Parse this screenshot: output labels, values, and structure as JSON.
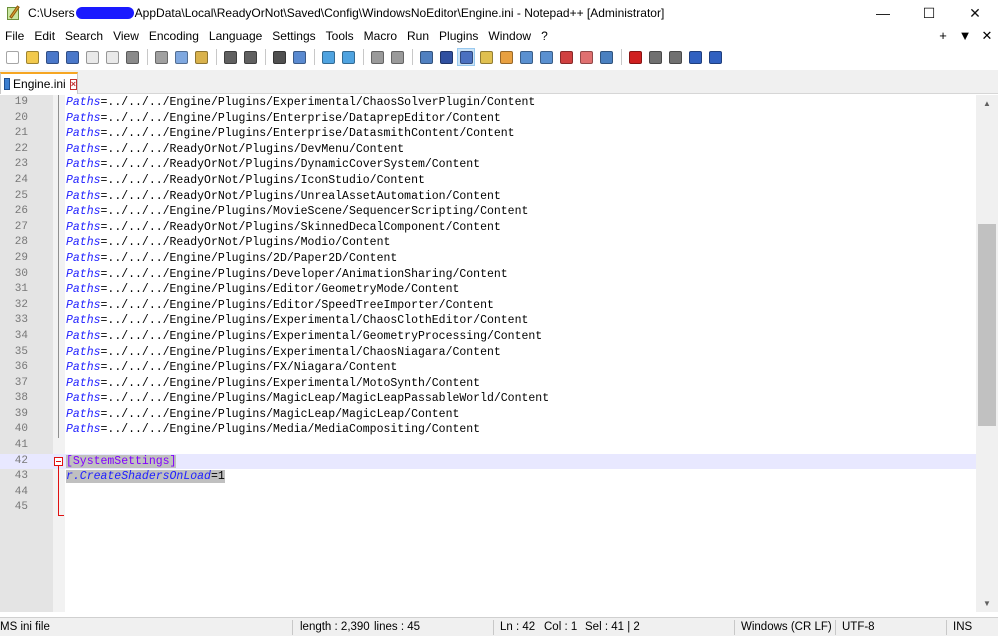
{
  "window": {
    "title_prefix": "C:\\Users",
    "title_suffix": "AppData\\Local\\ReadyOrNot\\Saved\\Config\\WindowsNoEditor\\Engine.ini - Notepad++ [Administrator]",
    "minimize_glyph": "—",
    "maximize_glyph": "☐",
    "close_glyph": "✕"
  },
  "menu": {
    "items": [
      "File",
      "Edit",
      "Search",
      "View",
      "Encoding",
      "Language",
      "Settings",
      "Tools",
      "Macro",
      "Run",
      "Plugins",
      "Window",
      "?"
    ],
    "right": {
      "plus": "+",
      "down": "▼",
      "close": "✕"
    }
  },
  "toolbar": {
    "buttons": [
      {
        "icon": "new-file-icon",
        "color": "#ffffff"
      },
      {
        "icon": "open-file-icon",
        "color": "#f2c94c"
      },
      {
        "icon": "save-icon",
        "color": "#4a77c9"
      },
      {
        "icon": "save-all-icon",
        "color": "#4a77c9"
      },
      {
        "icon": "close-file-icon",
        "color": "#e9e9e9"
      },
      {
        "icon": "close-all-icon",
        "color": "#e9e9e9"
      },
      {
        "icon": "print-icon",
        "color": "#8a8a8a"
      },
      {
        "sep": true
      },
      {
        "icon": "cut-icon",
        "color": "#a0a0a0"
      },
      {
        "icon": "copy-icon",
        "color": "#7fa8e0"
      },
      {
        "icon": "paste-icon",
        "color": "#d9b24c"
      },
      {
        "sep": true
      },
      {
        "icon": "undo-icon",
        "color": "#606060"
      },
      {
        "icon": "redo-icon",
        "color": "#606060"
      },
      {
        "sep": true
      },
      {
        "icon": "find-icon",
        "color": "#505050"
      },
      {
        "icon": "replace-icon",
        "color": "#5a8ad0"
      },
      {
        "sep": true
      },
      {
        "icon": "zoom-in-icon",
        "color": "#4fa3e0"
      },
      {
        "icon": "zoom-out-icon",
        "color": "#4fa3e0"
      },
      {
        "sep": true
      },
      {
        "icon": "sync-vertical-icon",
        "color": "#9a9a9a"
      },
      {
        "icon": "sync-horizontal-icon",
        "color": "#9a9a9a"
      },
      {
        "sep": true
      },
      {
        "icon": "word-wrap-icon",
        "color": "#5080c0"
      },
      {
        "icon": "show-all-chars-icon",
        "color": "#3050a0"
      },
      {
        "icon": "indent-guide-icon",
        "color": "#4a70c0",
        "active": true
      },
      {
        "icon": "udl-icon",
        "color": "#e0c050"
      },
      {
        "icon": "doc-map-icon",
        "color": "#e8a040"
      },
      {
        "icon": "function-list-icon",
        "color": "#5a90d0"
      },
      {
        "icon": "folder-workspace-icon",
        "color": "#5a90d0"
      },
      {
        "icon": "doc-list-icon",
        "color": "#d04040"
      },
      {
        "icon": "monitoring-icon",
        "color": "#e07070"
      },
      {
        "icon": "eye-icon",
        "color": "#4a80c0"
      },
      {
        "sep": true
      },
      {
        "icon": "record-macro-icon",
        "color": "#d02020"
      },
      {
        "icon": "stop-macro-icon",
        "color": "#707070"
      },
      {
        "icon": "play-macro-icon",
        "color": "#707070"
      },
      {
        "icon": "play-multiple-icon",
        "color": "#3060c0"
      },
      {
        "icon": "save-macro-icon",
        "color": "#3060c0"
      }
    ]
  },
  "tab": {
    "label": "Engine.ini"
  },
  "editor": {
    "lines": [
      {
        "n": "19",
        "key": "Paths",
        "val": "../../../Engine/Plugins/Experimental/ChaosSolverPlugin/Content"
      },
      {
        "n": "20",
        "key": "Paths",
        "val": "../../../Engine/Plugins/Enterprise/DataprepEditor/Content"
      },
      {
        "n": "21",
        "key": "Paths",
        "val": "../../../Engine/Plugins/Enterprise/DatasmithContent/Content"
      },
      {
        "n": "22",
        "key": "Paths",
        "val": "../../../ReadyOrNot/Plugins/DevMenu/Content"
      },
      {
        "n": "23",
        "key": "Paths",
        "val": "../../../ReadyOrNot/Plugins/DynamicCoverSystem/Content"
      },
      {
        "n": "24",
        "key": "Paths",
        "val": "../../../ReadyOrNot/Plugins/IconStudio/Content"
      },
      {
        "n": "25",
        "key": "Paths",
        "val": "../../../ReadyOrNot/Plugins/UnrealAssetAutomation/Content"
      },
      {
        "n": "26",
        "key": "Paths",
        "val": "../../../Engine/Plugins/MovieScene/SequencerScripting/Content"
      },
      {
        "n": "27",
        "key": "Paths",
        "val": "../../../ReadyOrNot/Plugins/SkinnedDecalComponent/Content"
      },
      {
        "n": "28",
        "key": "Paths",
        "val": "../../../ReadyOrNot/Plugins/Modio/Content"
      },
      {
        "n": "29",
        "key": "Paths",
        "val": "../../../Engine/Plugins/2D/Paper2D/Content"
      },
      {
        "n": "30",
        "key": "Paths",
        "val": "../../../Engine/Plugins/Developer/AnimationSharing/Content"
      },
      {
        "n": "31",
        "key": "Paths",
        "val": "../../../Engine/Plugins/Editor/GeometryMode/Content"
      },
      {
        "n": "32",
        "key": "Paths",
        "val": "../../../Engine/Plugins/Editor/SpeedTreeImporter/Content"
      },
      {
        "n": "33",
        "key": "Paths",
        "val": "../../../Engine/Plugins/Experimental/ChaosClothEditor/Content"
      },
      {
        "n": "34",
        "key": "Paths",
        "val": "../../../Engine/Plugins/Experimental/GeometryProcessing/Content"
      },
      {
        "n": "35",
        "key": "Paths",
        "val": "../../../Engine/Plugins/Experimental/ChaosNiagara/Content"
      },
      {
        "n": "36",
        "key": "Paths",
        "val": "../../../Engine/Plugins/FX/Niagara/Content"
      },
      {
        "n": "37",
        "key": "Paths",
        "val": "../../../Engine/Plugins/Experimental/MotoSynth/Content"
      },
      {
        "n": "38",
        "key": "Paths",
        "val": "../../../Engine/Plugins/MagicLeap/MagicLeapPassableWorld/Content"
      },
      {
        "n": "39",
        "key": "Paths",
        "val": "../../../Engine/Plugins/MagicLeap/MagicLeap/Content"
      },
      {
        "n": "40",
        "key": "Paths",
        "val": "../../../Engine/Plugins/Media/MediaCompositing/Content"
      },
      {
        "n": "41",
        "kind": "empty"
      },
      {
        "n": "42",
        "kind": "section",
        "text": "[SystemSettings]"
      },
      {
        "n": "43",
        "kind": "setting",
        "key": "r.CreateShadersOnLoad",
        "val": "1"
      },
      {
        "n": "44",
        "kind": "empty"
      },
      {
        "n": "45",
        "kind": "empty"
      }
    ]
  },
  "status": {
    "file_type": "MS ini file",
    "length": "length : 2,390",
    "lines": "lines : 45",
    "ln": "Ln : 42",
    "col": "Col : 1",
    "sel": "Sel : 41 | 2",
    "eol": "Windows (CR LF)",
    "encoding": "UTF-8",
    "mode": "INS"
  }
}
